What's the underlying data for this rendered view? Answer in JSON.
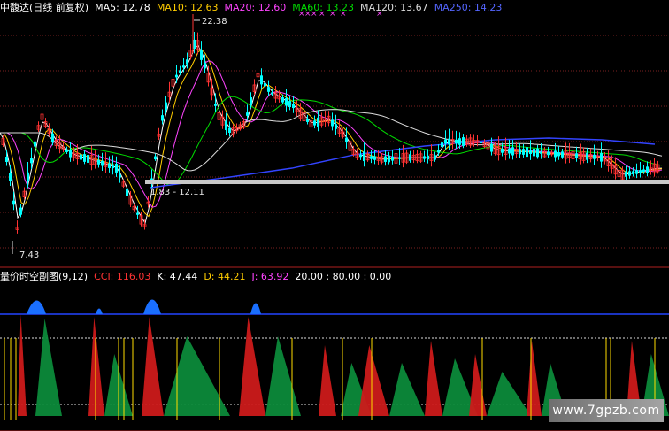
{
  "main_legend": {
    "title": "中馥达(日线 前复权)",
    "ma5": "MA5: 12.78",
    "ma10": "MA10: 12.63",
    "ma20": "MA20: 12.60",
    "ma60": "MA60: 13.23",
    "ma120": "MA120: 13.67",
    "ma250": "MA250: 14.23"
  },
  "price_labels": {
    "high": "22.38",
    "low": "7.43",
    "support": "1.83 - 12.11"
  },
  "sub_legend": {
    "title": "量价时空副图(9,12)",
    "cci": "CCI: 116.03",
    "k": "K: 47.44",
    "d": "D: 44.21",
    "j": "J: 63.92",
    "levels": "20.00 : 80.00 : 0.00"
  },
  "watermark": "www.7gpzb.com",
  "colors": {
    "ma5": "#ffffff",
    "ma10": "#ffcc00",
    "ma20": "#ff44ff",
    "ma60": "#00dd00",
    "ma120": "#dddddd",
    "ma250": "#3344ff",
    "up": "#ff3333",
    "down": "#00ffff",
    "cci": "#ff2222",
    "kdj": "#00aa44",
    "blue_fill": "#1a6fff",
    "yellow": "#ffdd00"
  }
}
